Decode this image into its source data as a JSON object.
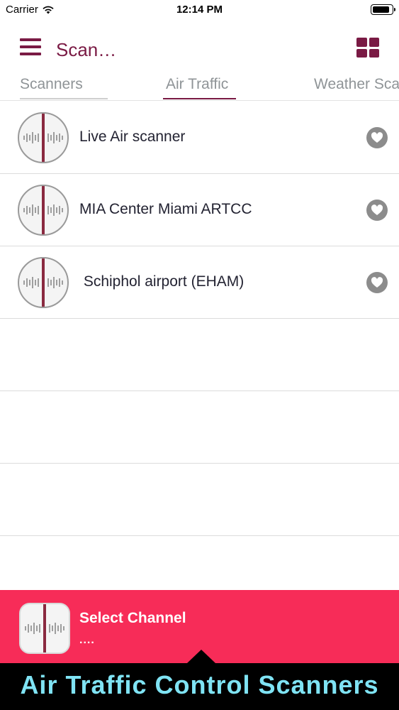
{
  "status_bar": {
    "carrier": "Carrier",
    "time": "12:14 PM",
    "battery_level": 0.9
  },
  "nav": {
    "title": "Scan…",
    "menu_icon": "hamburger-icon",
    "grid_icon": "grid-view-icon",
    "accent": "#7a1a44"
  },
  "tabs": [
    {
      "label": "Scanners",
      "selected": false
    },
    {
      "label": "Air Traffic",
      "selected": true
    },
    {
      "label": "Weather Sca",
      "selected": false
    }
  ],
  "channels": [
    {
      "name": "Live Air scanner",
      "icon": "radio-dial-icon",
      "favorite_icon": "heart-icon"
    },
    {
      "name": "MIA Center Miami ARTCC",
      "icon": "radio-dial-icon",
      "favorite_icon": "heart-icon"
    },
    {
      "name": " Schiphol airport (EHAM)",
      "icon": "radio-dial-icon",
      "favorite_icon": "heart-icon"
    }
  ],
  "player": {
    "title": "Select Channel",
    "subtitle": "....",
    "background": "#f72c58"
  },
  "caption": {
    "text": "Air Traffic Control Scanners",
    "color": "#7fe3f4"
  }
}
